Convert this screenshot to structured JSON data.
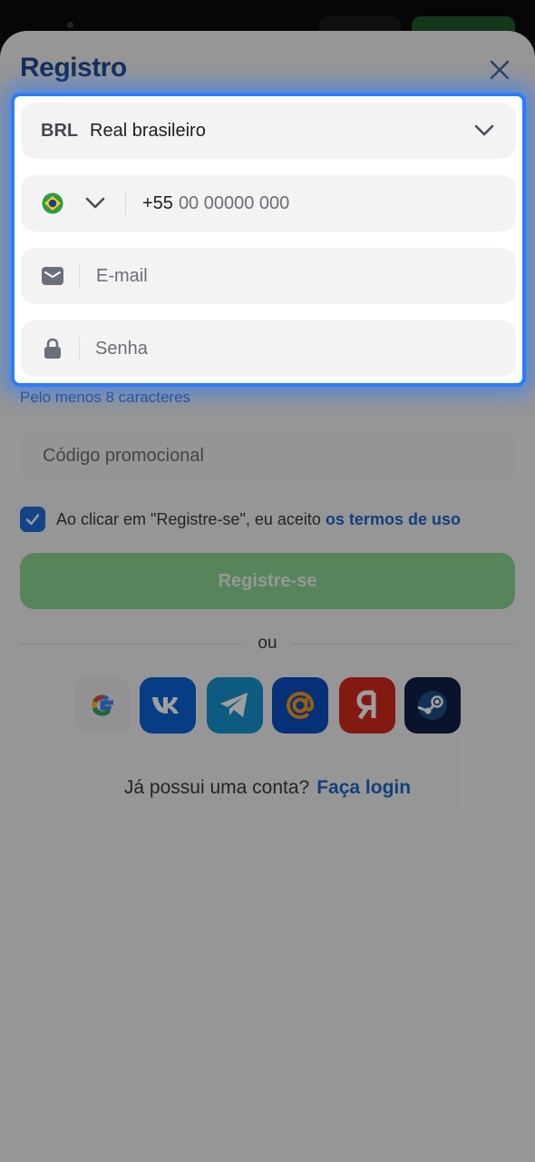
{
  "sheet": {
    "title": "Registro",
    "hint": "Pelo menos 8 caracteres",
    "promo_placeholder": "Código promocional",
    "terms_text": "Ao clicar em \"Registre-se\", eu aceito",
    "terms_link": "os termos de uso",
    "register_label": "Registre-se",
    "or_label": "ou",
    "login_question": "Já possui uma conta?",
    "login_link": "Faça login",
    "terms_checked": true
  },
  "form": {
    "currency_code": "BRL",
    "currency_name": "Real brasileiro",
    "phone_code": "+55",
    "phone_placeholder": "00 00000 000",
    "email_placeholder": "E-mail",
    "password_placeholder": "Senha"
  },
  "social": [
    "google-icon",
    "vk-icon",
    "telegram-icon",
    "mail-ru-icon",
    "yandex-icon",
    "steam-icon"
  ],
  "colors": {
    "title": "#1c4b8f",
    "link": "#1f66cc",
    "register_button": "#8fd694",
    "highlight_border": "#2b7cff"
  }
}
